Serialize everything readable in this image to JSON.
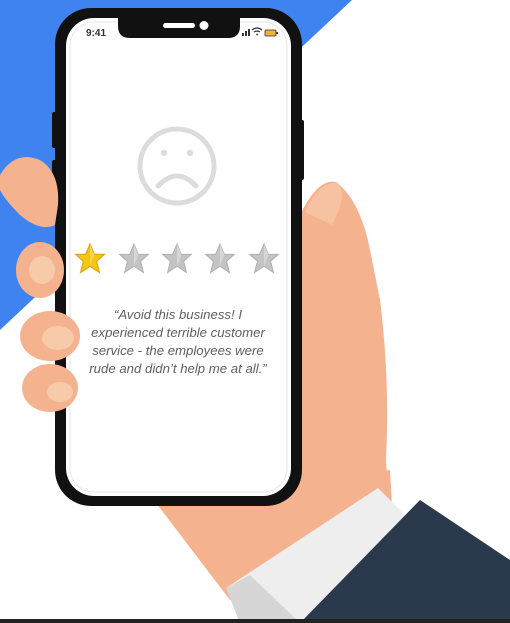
{
  "status_bar": {
    "time": "9:41"
  },
  "rating": {
    "value": 1,
    "max": 5
  },
  "review": {
    "quote": "“Avoid this business! I experienced terrible customer service - the employees were rude and didn’t help me at all.”"
  },
  "icons": {
    "mood": "sad-face-icon",
    "star": "star-icon",
    "signal": "signal-icon",
    "wifi": "wifi-icon",
    "battery": "battery-icon"
  },
  "colors": {
    "background_shape": "#3f83f0",
    "skin": "#f4b28e",
    "sleeve": "#2a3a4c",
    "cuff": "#eeeeee",
    "phone_frame": "#111111",
    "star_filled": "#f5c518",
    "star_empty": "#c4c4c4",
    "text": "#5f5f5f"
  }
}
